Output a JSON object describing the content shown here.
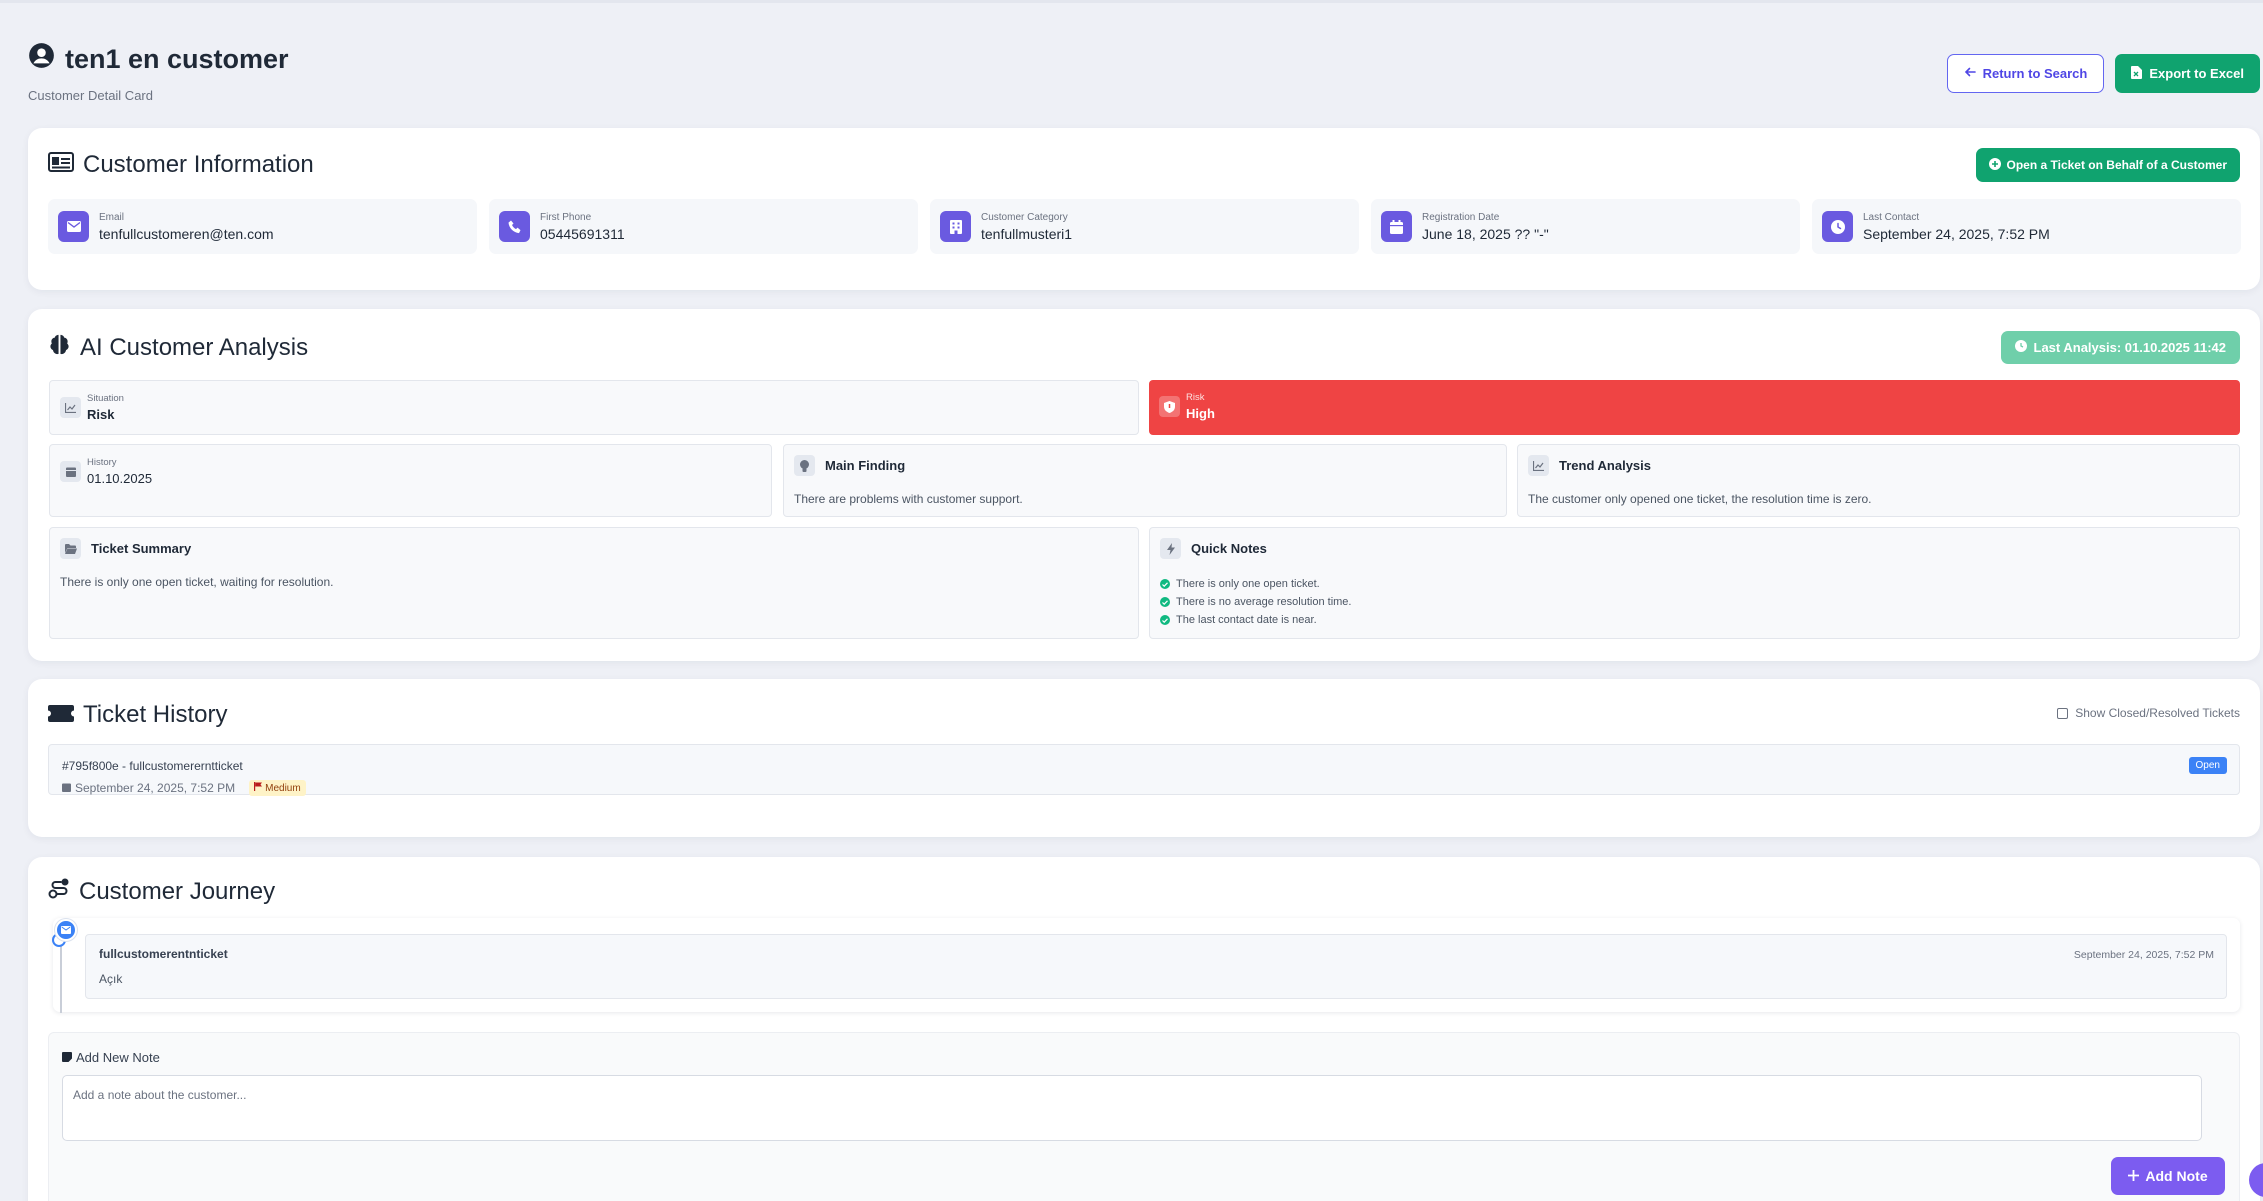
{
  "header": {
    "title": "ten1 en customer",
    "subtitle": "Customer Detail Card",
    "return_label": "Return to Search",
    "export_label": "Export to Excel"
  },
  "customer_info": {
    "title": "Customer Information",
    "open_ticket_label": "Open a Ticket on Behalf of a Customer",
    "fields": [
      {
        "label": "Email",
        "value": "tenfullcustomeren@ten.com",
        "icon": "envelope-icon"
      },
      {
        "label": "First Phone",
        "value": "05445691311",
        "icon": "phone-icon"
      },
      {
        "label": "Customer Category",
        "value": "tenfullmusteri1",
        "icon": "building-icon"
      },
      {
        "label": "Registration Date",
        "value": "June 18, 2025 ?? \"-\"",
        "icon": "calendar-icon"
      },
      {
        "label": "Last Contact",
        "value": "September 24, 2025, 7:52 PM",
        "icon": "clock-icon"
      }
    ]
  },
  "ai_analysis": {
    "title": "AI Customer Analysis",
    "last_analysis": "Last Analysis: 01.10.2025 11:42",
    "situation": {
      "label": "Situation",
      "value": "Risk"
    },
    "risk": {
      "label": "Risk",
      "value": "High",
      "color": "#ef4444"
    },
    "history": {
      "label": "History",
      "value": "01.10.2025"
    },
    "main_finding": {
      "title": "Main Finding",
      "text": "There are problems with customer support."
    },
    "trend_analysis": {
      "title": "Trend Analysis",
      "text": "The customer only opened one ticket, the resolution time is zero."
    },
    "ticket_summary": {
      "title": "Ticket Summary",
      "text": "There is only one open ticket, waiting for resolution."
    },
    "quick_notes": {
      "title": "Quick Notes",
      "items": [
        "There is only one open ticket.",
        "There is no average resolution time.",
        "The last contact date is near."
      ]
    }
  },
  "ticket_history": {
    "title": "Ticket History",
    "toggle_label": "Show Closed/Resolved Tickets",
    "tickets": [
      {
        "title": "#795f800e - fullcustomererntticket",
        "date": "September 24, 2025, 7:52 PM",
        "priority": "Medium",
        "status": "Open"
      }
    ]
  },
  "journey": {
    "title": "Customer Journey",
    "items": [
      {
        "name": "fullcustomerentnticket",
        "date": "September 24, 2025, 7:52 PM",
        "status": "Açık"
      }
    ],
    "note": {
      "title": "Add New Note",
      "placeholder": "Add a note about the customer...",
      "button_label": "Add Note"
    }
  },
  "colors": {
    "accent": "#6a5ae0",
    "success": "#10a36f",
    "danger": "#ef4444",
    "info": "#3b82f6"
  }
}
